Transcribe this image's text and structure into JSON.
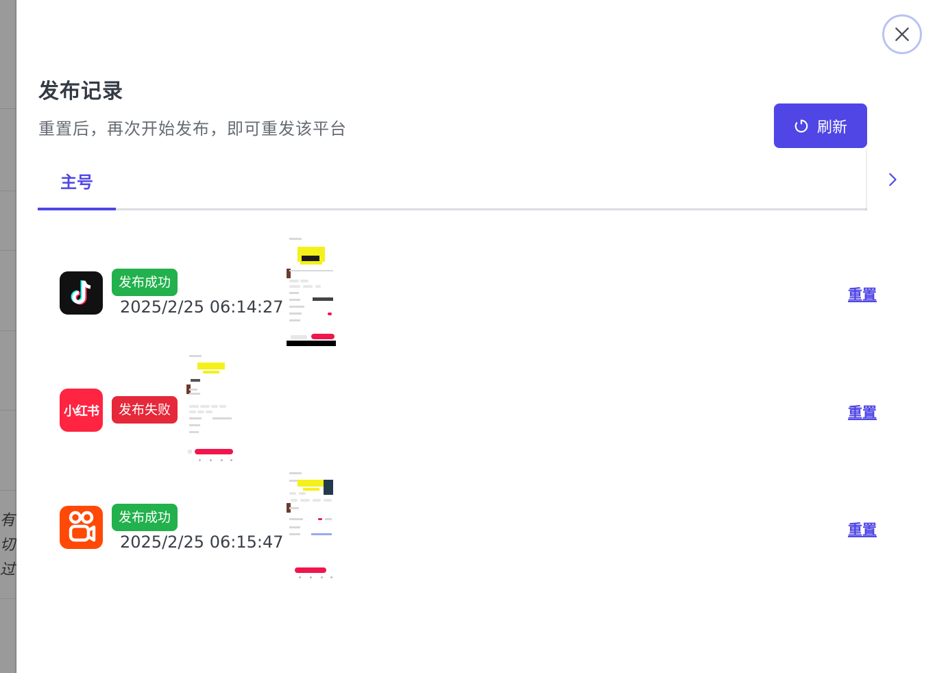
{
  "background": {
    "text_lines": [
      "有",
      "切",
      "过"
    ]
  },
  "drawer": {
    "title": "发布记录",
    "subtitle": "重置后，再次开始发布，即可重发该平台",
    "refresh_label": "刷新",
    "close_icon": "close-icon",
    "tabs": [
      {
        "label": "主号",
        "active": true
      }
    ]
  },
  "records": [
    {
      "platform": "抖音",
      "icon": "douyin-icon",
      "status": "发布成功",
      "status_color": "#22b14c",
      "time": "2025/2/25 06:14:27",
      "reset_label": "重置"
    },
    {
      "platform": "小红书",
      "icon_text": "小红书",
      "icon": "xiaohongshu-icon",
      "status": "发布失败",
      "status_color": "#e5283a",
      "time": "",
      "reset_label": "重置"
    },
    {
      "platform": "快手",
      "icon": "kuaishou-icon",
      "status": "发布成功",
      "status_color": "#22b14c",
      "time": "2025/2/25 06:15:47",
      "reset_label": "重置"
    }
  ],
  "colors": {
    "accent": "#4f46e5",
    "success": "#22b14c",
    "fail": "#e5283a"
  }
}
